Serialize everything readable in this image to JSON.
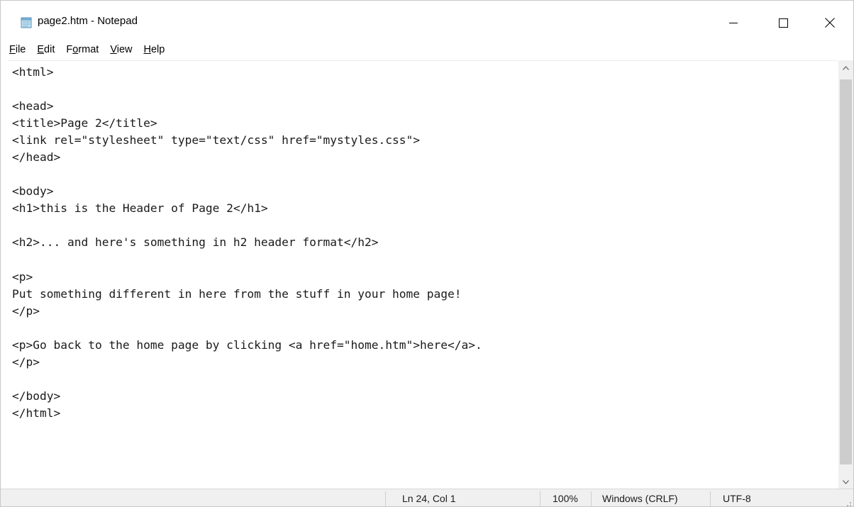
{
  "window": {
    "title": "page2.htm - Notepad",
    "icon": "notepad-icon",
    "controls": {
      "minimize": "minimize-icon",
      "maximize": "maximize-icon",
      "close": "close-icon"
    }
  },
  "menu": {
    "items": [
      {
        "accel": "F",
        "rest": "ile"
      },
      {
        "accel": "E",
        "rest": "dit"
      },
      {
        "pre": "F",
        "accel": "o",
        "rest": "rmat"
      },
      {
        "accel": "V",
        "rest": "iew"
      },
      {
        "accel": "H",
        "rest": "elp"
      }
    ]
  },
  "editor": {
    "lines": [
      "<html>",
      "",
      "<head>",
      "<title>Page 2</title>",
      "<link rel=\"stylesheet\" type=\"text/css\" href=\"mystyles.css\">",
      "</head>",
      "",
      "<body>",
      "<h1>this is the Header of Page 2</h1>",
      "",
      "<h2>... and here's something in h2 header format</h2>",
      "",
      "<p>",
      "Put something different in here from the stuff in your home page!",
      "</p>",
      "",
      "<p>Go back to the home page by clicking <a href=\"home.htm\">here</a>.",
      "</p>",
      "",
      "</body>",
      "</html>"
    ]
  },
  "status": {
    "position": "Ln 24, Col 1",
    "zoom": "100%",
    "line_ending": "Windows (CRLF)",
    "encoding": "UTF-8"
  },
  "colors": {
    "scrollbar_track": "#f0f0f0",
    "scrollbar_thumb": "#cdcdcd",
    "status_bar": "#f0f0f0"
  }
}
